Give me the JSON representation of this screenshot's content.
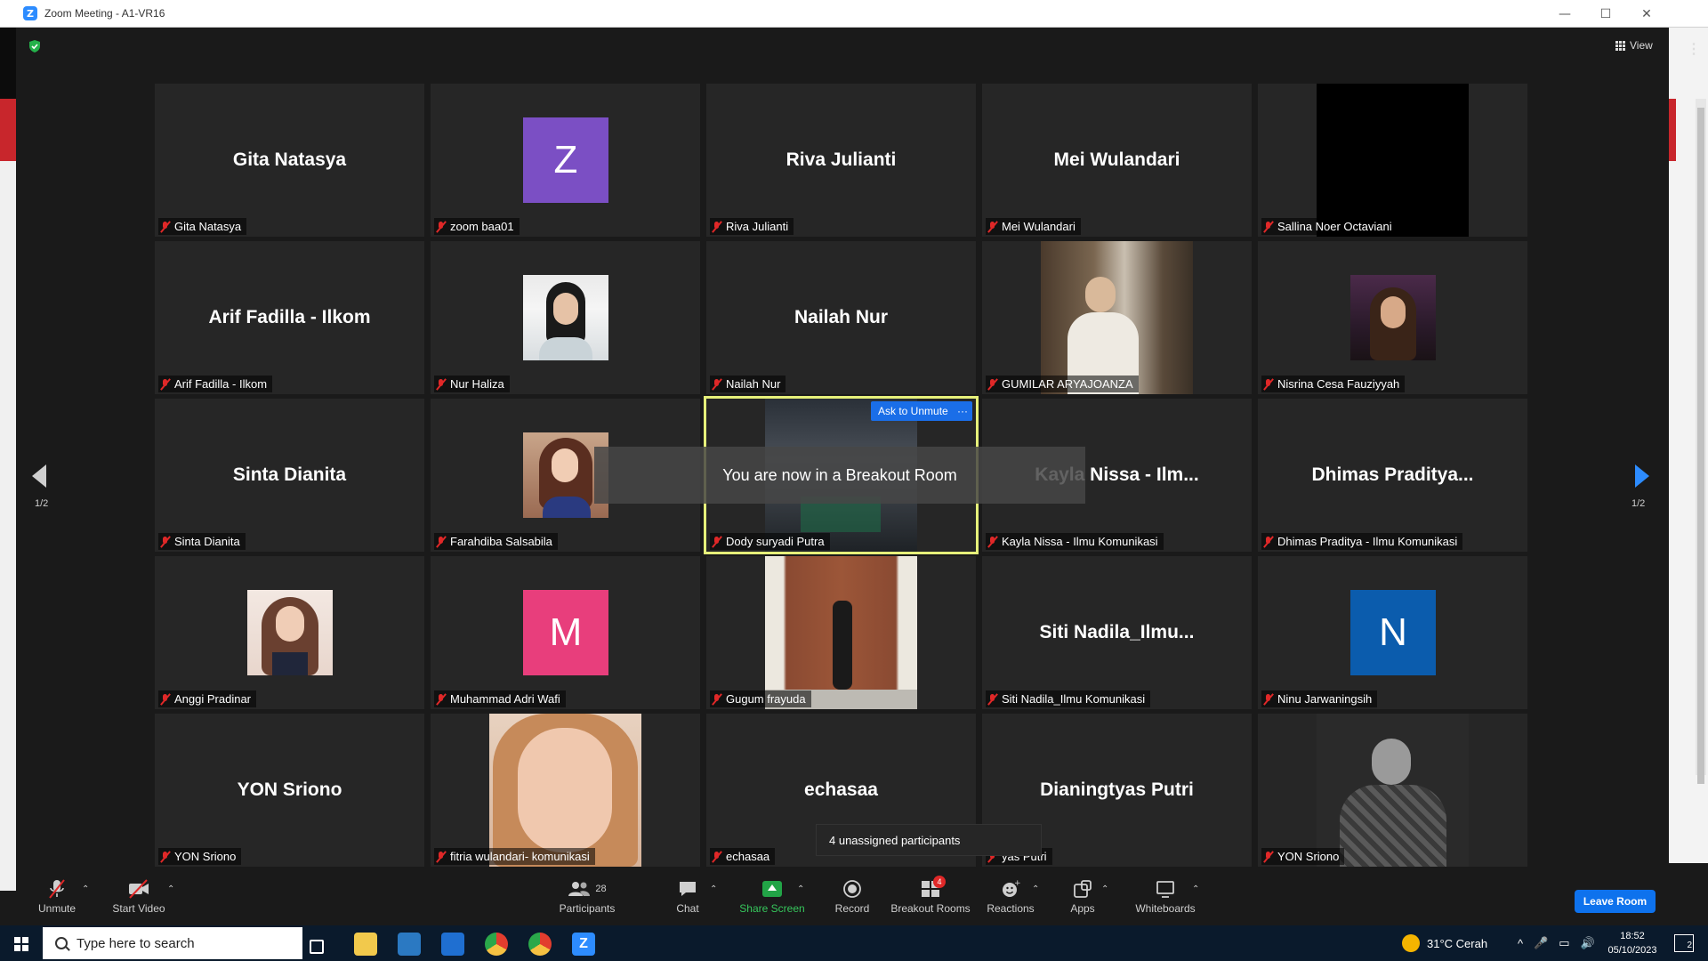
{
  "window": {
    "title": "Zoom Meeting - A1-VR16",
    "minimize": "—",
    "maximize": "☐",
    "close": "✕"
  },
  "header": {
    "view_label": "View"
  },
  "tiles": [
    {
      "display": "Gita Natasya",
      "label": "Gita Natasya"
    },
    {
      "display": "Z",
      "label": "zoom baa01",
      "color": "#7b4fc4"
    },
    {
      "display": "Riva Julianti",
      "label": "Riva Julianti"
    },
    {
      "display": "Mei Wulandari",
      "label": "Mei Wulandari"
    },
    {
      "display": "",
      "label": "Sallina Noer Octaviani"
    },
    {
      "display": "Arif Fadilla - Ilkom",
      "label": "Arif Fadilla - Ilkom"
    },
    {
      "display": "",
      "label": "Nur Haliza"
    },
    {
      "display": "Nailah Nur",
      "label": "Nailah Nur"
    },
    {
      "display": "",
      "label": "GUMILAR ARYAJOANZA"
    },
    {
      "display": "",
      "label": "Nisrina Cesa Fauziyyah"
    },
    {
      "display": "Sinta Dianita",
      "label": "Sinta Dianita"
    },
    {
      "display": "",
      "label": "Farahdiba Salsabila"
    },
    {
      "display": "",
      "label": "Dody suryadi Putra"
    },
    {
      "display": "Kayla Nissa - Ilm...",
      "label": "Kayla Nissa - Ilmu Komunikasi"
    },
    {
      "display": "Dhimas Praditya...",
      "label": "Dhimas Praditya - Ilmu Komunikasi"
    },
    {
      "display": "",
      "label": "Anggi Pradinar"
    },
    {
      "display": "M",
      "label": "Muhammad Adri Wafi",
      "color": "#e83e7c"
    },
    {
      "display": "",
      "label": "Gugum frayuda"
    },
    {
      "display": "Siti Nadila_Ilmu...",
      "label": "Siti Nadila_Ilmu Komunikasi"
    },
    {
      "display": "N",
      "label": "Ninu Jarwaningsih",
      "color": "#0b5cad"
    },
    {
      "display": "YON Sriono",
      "label": "YON Sriono"
    },
    {
      "display": "",
      "label": "fitria wulandari- komunikasi"
    },
    {
      "display": "echasaa",
      "label": "echasaa"
    },
    {
      "display": "Dianingtyas Putri",
      "label": "yas Putri"
    },
    {
      "display": "",
      "label": "YON Sriono"
    }
  ],
  "active_tile": {
    "ask_unmute": "Ask to Unmute",
    "more": "···"
  },
  "toast": "You are now in a Breakout Room",
  "pager": {
    "left_page": "1/2",
    "right_page": "1/2"
  },
  "unassigned": "4 unassigned participants",
  "toolbar": {
    "unmute": "Unmute",
    "start_video": "Start Video",
    "participants": "Participants",
    "participants_count": "28",
    "chat": "Chat",
    "share_screen": "Share Screen",
    "record": "Record",
    "breakout_rooms": "Breakout Rooms",
    "breakout_badge": "4",
    "reactions": "Reactions",
    "apps": "Apps",
    "whiteboards": "Whiteboards",
    "leave_room": "Leave Room"
  },
  "taskbar": {
    "search_placeholder": "Type here to search",
    "weather": "31°C  Cerah",
    "time": "18:52",
    "date": "05/10/2023",
    "notifications": "2"
  },
  "colors": {
    "accent": "#2d8cff",
    "share_green": "#22a447",
    "muted_red": "#e02828",
    "active_border": "#e6f07a"
  }
}
